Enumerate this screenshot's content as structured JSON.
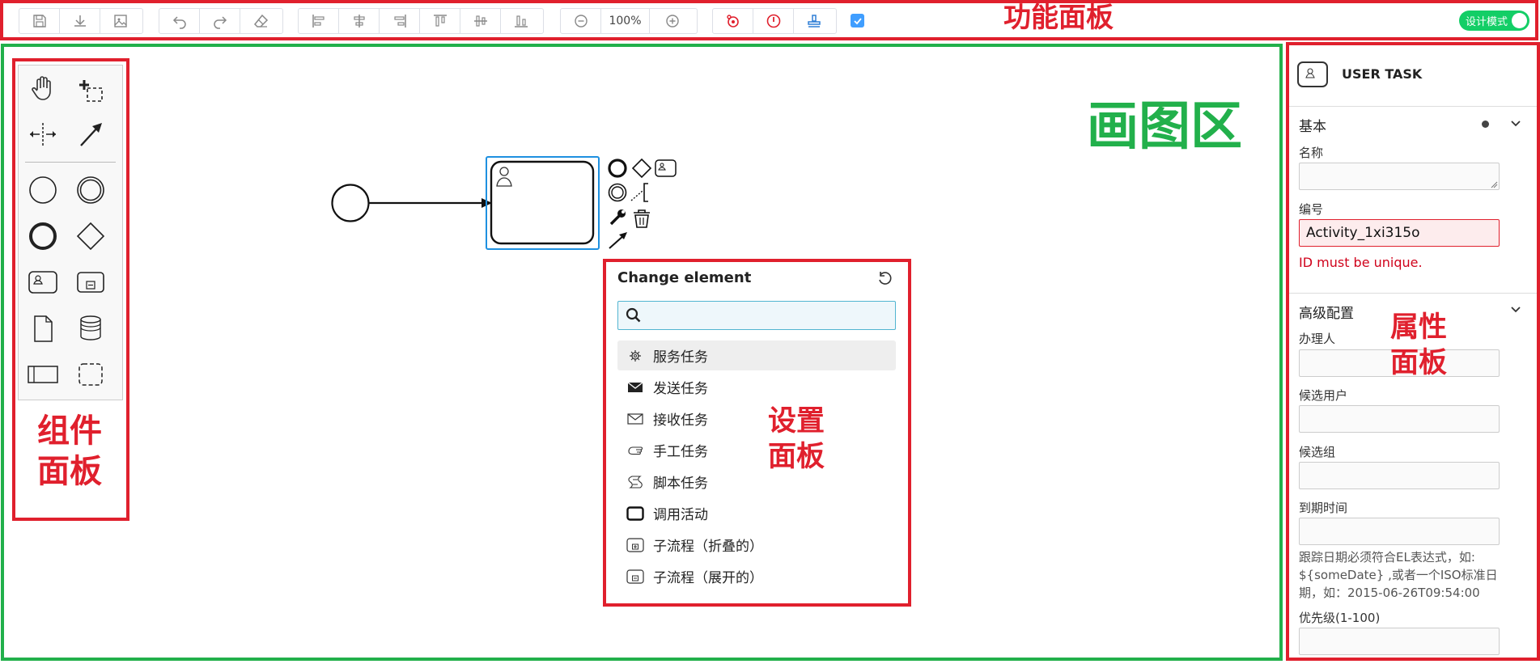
{
  "toolbar": {
    "buttons": [
      "save-icon",
      "download-icon",
      "image-icon",
      "undo-icon",
      "redo-icon",
      "eraser-icon",
      "align-left-icon",
      "align-center-icon",
      "align-right-icon",
      "align-top-icon",
      "align-middle-icon",
      "align-bottom-icon",
      "zoom-out-icon",
      "zoom-in-icon",
      "process-icon",
      "timer-icon",
      "stamp-icon"
    ],
    "zoom_value": "100%",
    "checkbox_checked": true,
    "design_mode_label": "设计模式",
    "design_mode_on": true
  },
  "annotations": {
    "function_panel": "功能面板",
    "drawing_area": "画图区",
    "component_panel_line1": "组件",
    "component_panel_line2": "面板",
    "settings_panel_line1": "设置",
    "settings_panel_line2": "面板",
    "property_panel_line1": "属性",
    "property_panel_line2": "面板"
  },
  "palette": {
    "tools": [
      "hand-tool-icon",
      "lasso-tool-icon",
      "space-tool-icon",
      "connect-tool-icon",
      "start-event-icon",
      "intermediate-event-icon",
      "end-event-icon",
      "gateway-icon",
      "user-task-icon",
      "subprocess-icon",
      "data-object-icon",
      "data-store-icon",
      "pool-icon",
      "group-icon"
    ]
  },
  "popup": {
    "title": "Change element",
    "search_placeholder": "",
    "items": [
      {
        "label": "服务任务",
        "icon": "gear-icon"
      },
      {
        "label": "发送任务",
        "icon": "envelope-filled-icon"
      },
      {
        "label": "接收任务",
        "icon": "envelope-icon"
      },
      {
        "label": "手工任务",
        "icon": "hand-icon"
      },
      {
        "label": "脚本任务",
        "icon": "script-icon"
      },
      {
        "label": "调用活动",
        "icon": "call-activity-icon"
      },
      {
        "label": "子流程（折叠的）",
        "icon": "subprocess-collapsed-icon"
      },
      {
        "label": "子流程（展开的）",
        "icon": "subprocess-expanded-icon"
      }
    ]
  },
  "properties": {
    "element_type": "USER TASK",
    "basic_section": "基本",
    "name_label": "名称",
    "name_value": "",
    "id_label": "编号",
    "id_value": "Activity_1xi315o",
    "id_error": "ID must be unique.",
    "advanced_section": "高级配置",
    "assignee_label": "办理人",
    "candidate_users_label": "候选用户",
    "candidate_groups_label": "候选组",
    "due_date_label": "到期时间",
    "due_date_hint": "跟踪日期必须符合EL表达式，如: ${someDate} ,或者一个ISO标准日期，如：2015-06-26T09:54:00",
    "priority_label": "优先级(1-100)"
  },
  "colors": {
    "annotation_red": "#e0202d",
    "annotation_green": "#22b04b",
    "selection_blue": "#1e90e0",
    "toggle_green": "#13ce66",
    "checkbox_blue": "#409eff"
  }
}
